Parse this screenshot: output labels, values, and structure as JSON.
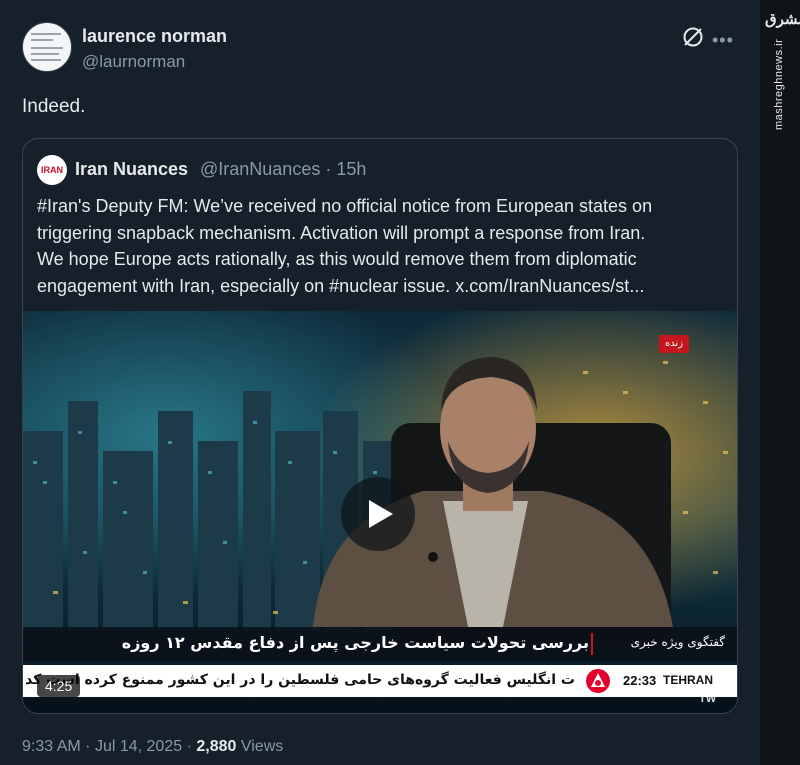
{
  "author": {
    "display_name": "laurence norman",
    "handle": "@laurnorman",
    "avatar_text": "laurence norman"
  },
  "tweet": {
    "text": "Indeed."
  },
  "quoted": {
    "display_name": "Iran Nuances",
    "handle": "@IranNuances",
    "age": "15h",
    "avatar_text": "IRAN",
    "body_lines": [
      "#Iran's Deputy FM: We’ve received no official notice from European states on",
      "triggering snapback mechanism. Activation will prompt a response from Iran.",
      "We hope Europe acts rationally, as this would remove them from diplomatic",
      "engagement with Iran, especially on #nuclear issue.  x.com/IranNuances/st..."
    ]
  },
  "video": {
    "live_badge": "زنده",
    "headline": "بررسی تحولات سیاست خارجی پس از دفاع مقدس ۱۲ روزه",
    "program": "گفتگوی ویژه خبری",
    "ticker": "ت انگلیس فعالیت گروه‌های حامی فلسطین را در این کشور ممنوع کرده است کد",
    "clock": "22:33",
    "city": "TEHRAN",
    "watermark": "TW",
    "duration": "4:25"
  },
  "footer": {
    "time": "9:33 AM",
    "sep": "·",
    "date": "Jul 14, 2025",
    "views_count": "2,880",
    "views_label": "Views"
  },
  "brand": {
    "logo": "مشرق",
    "url": "mashreghnews.ir"
  },
  "icons": {
    "grok": "grok-icon",
    "more": "more-icon",
    "play": "play-icon"
  }
}
